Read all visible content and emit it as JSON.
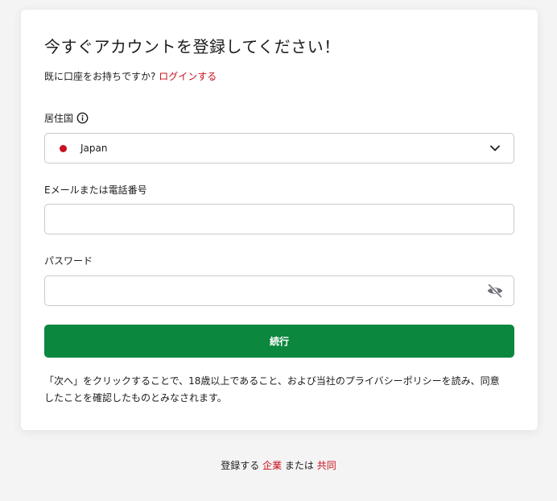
{
  "header": {
    "title": "今すぐアカウントを登録してください！",
    "login_prompt": "既に口座をお持ちですか?",
    "login_link": "ログインする"
  },
  "form": {
    "country": {
      "label": "居住国",
      "info_icon": "info-circle-icon",
      "value": "Japan",
      "flag_color": "#c8101e",
      "chevron_icon": "chevron-down-icon"
    },
    "email": {
      "label": "Eメールまたは電話番号",
      "value": ""
    },
    "password": {
      "label": "パスワード",
      "value": "",
      "toggle_icon": "eye-slash-icon"
    },
    "submit_label": "続行"
  },
  "terms": {
    "text": "「次へ」をクリックすることで、18歳以上であること、および当社のプライバシーポリシーを読み、同意したことを確認したものとみなされます。"
  },
  "footer": {
    "prefix": "登録する",
    "business_link": "企業",
    "middle": "または",
    "joint_link": "共同"
  },
  "colors": {
    "accent_red": "#c8101e",
    "button_green": "#0c873e",
    "background": "#f4f4f4"
  }
}
